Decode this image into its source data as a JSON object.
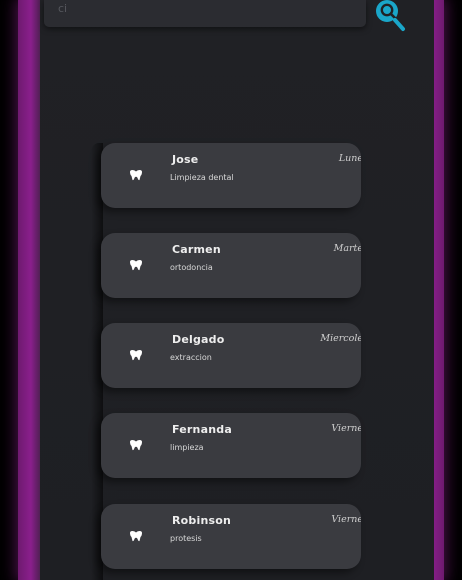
{
  "search": {
    "text": "ci"
  },
  "appointments": [
    {
      "name": "Jose",
      "treatment": "Limpieza dental",
      "day": "Lune"
    },
    {
      "name": "Carmen",
      "treatment": "ortodoncia",
      "day": "Marte"
    },
    {
      "name": "Delgado",
      "treatment": "extraccion",
      "day": "Miercole"
    },
    {
      "name": "Fernanda",
      "treatment": "limpieza",
      "day": "Vierne"
    },
    {
      "name": "Robinson",
      "treatment": "protesis",
      "day": "Vierne"
    }
  ],
  "icons": {
    "search": "search-icon",
    "item": "tooth-icon"
  },
  "colors": {
    "accent": "#1aa6c9",
    "frame": "#8a1f8c",
    "card": "#3a3b40",
    "background": "#202125"
  }
}
